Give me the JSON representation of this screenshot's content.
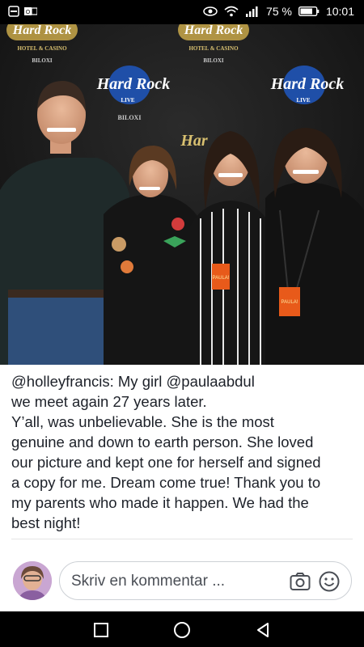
{
  "status_bar": {
    "left_icons": [
      "notification-icon",
      "outlook-icon"
    ],
    "right_icons": [
      "eye-icon",
      "wifi-icon",
      "signal-icon"
    ],
    "battery_percent": "75 %",
    "time": "10:01"
  },
  "photo": {
    "backdrop_text_hard_rock": "Hard Rock",
    "backdrop_text_live": "LIVE",
    "backdrop_text_hotel": "HOTEL & CASINO",
    "backdrop_text_biloxi": "BILOXI",
    "badge_text": "PAULA!"
  },
  "caption": {
    "author": "@holleyfrancis",
    "text": ": My girl @paulaabdul\nwe meet again 27 years later.\nY’all, was unbelievable. She is the most\ngenuine and down to earth person.  She loved\nour picture and kept one for herself and signed\na copy for me. Dream come true! Thank you to\nmy parents who made it happen. We had the\nbest night!"
  },
  "comment_bar": {
    "placeholder": "Skriv en kommentar ..."
  },
  "colors": {
    "status_bg": "#000000",
    "text": "#1d2129",
    "placeholder": "#4b4f56",
    "input_border": "#ccd0d5"
  }
}
